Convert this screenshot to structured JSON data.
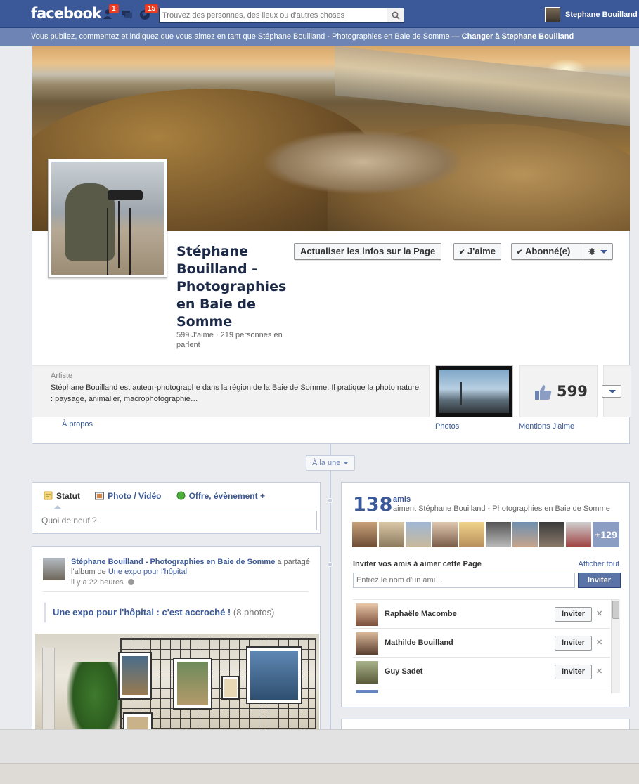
{
  "topbar": {
    "logo": "facebook",
    "badges": {
      "friends": "1",
      "messages": "",
      "notifications": "15"
    },
    "search_placeholder": "Trouvez des personnes, des lieux ou d'autres choses",
    "user_name": "Stephane Bouilland"
  },
  "notice": {
    "text": "Vous publiez, commentez et indiquez que vous aimez en tant que Stéphane Bouilland - Photographies en Baie de Somme — ",
    "switch_link": "Changer à Stephane Bouilland"
  },
  "page": {
    "name": "Stéphane Bouilland - Photographies en Baie de Somme",
    "stats": "599 J'aime · 219 personnes en parlent",
    "buttons": {
      "update_info": "Actualiser les infos sur la Page",
      "like": "J'aime",
      "follow": "Abonné(e)"
    },
    "about": {
      "category": "Artiste",
      "description": "Stéphane Bouilland est auteur-photographe dans la région de la Baie de Somme. Il pratique la photo nature : paysage, animalier, macrophotographie…",
      "link": "À propos"
    },
    "photos_label": "Photos",
    "likes_count": "599",
    "likes_label": "Mentions J'aime"
  },
  "timeline": {
    "filter": "À la une"
  },
  "composer": {
    "tabs": [
      "Statut",
      "Photo / Vidéo",
      "Offre, évènement +"
    ],
    "placeholder": "Quoi de neuf ?"
  },
  "post": {
    "author": "Stéphane Bouilland - Photographies en Baie de Somme",
    "action_pre": " a partagé l'album de ",
    "album_link": "Une expo pour l'hôpital",
    "action_post": ".",
    "time": "il y a 22 heures",
    "album_title": "Une expo pour l'hôpital : c'est accroché !",
    "album_count": "(8 photos)"
  },
  "friends": {
    "count": "138",
    "label": "amis",
    "sub": "aiment Stéphane Bouilland - Photographies en Baie de Somme",
    "more": "+129",
    "invite_title": "Inviter vos amis à aimer cette Page",
    "show_all": "Afficher tout",
    "input_placeholder": "Entrez le nom d'un ami…",
    "invite_button": "Inviter",
    "list": [
      {
        "name": "Raphaële Macombe",
        "button": "Inviter"
      },
      {
        "name": "Mathilde Bouilland",
        "button": "Inviter"
      },
      {
        "name": "Guy Sadet",
        "button": "Inviter"
      }
    ]
  },
  "colors": {
    "brand": "#3b5998",
    "notice_bar": "#6d84b4",
    "badge": "#f03d25"
  }
}
